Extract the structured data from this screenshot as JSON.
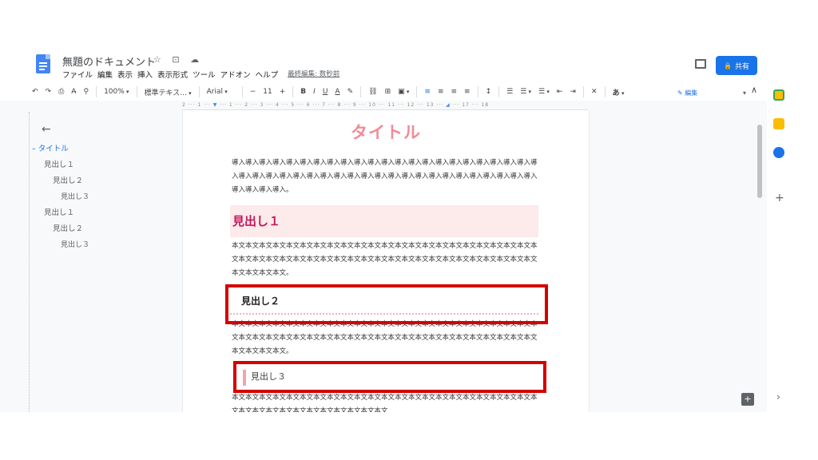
{
  "doc": {
    "title": "無題のドキュメント",
    "title_icons": "☆ ⊡ ☁",
    "menu": [
      "ファイル",
      "編集",
      "表示",
      "挿入",
      "表示形式",
      "ツール",
      "アドオン",
      "ヘルプ"
    ],
    "last_edit": "最終編集: 数秒前"
  },
  "header": {
    "share_label": "共有",
    "share_lock": "🔒"
  },
  "toolbar": {
    "undo": "↶",
    "redo": "↷",
    "print": "⎙",
    "spell": "A̶",
    "paint": "⚲",
    "zoom": "100%",
    "style": "標準テキス...",
    "font": "Arial",
    "minus": "−",
    "size": "11",
    "plus": "+",
    "bold": "B",
    "italic": "I",
    "underline": "U",
    "color": "A",
    "highlight": "✎",
    "link": "⛓",
    "comment": "⊞",
    "image": "▣",
    "align_left": "≡",
    "align_center": "≡",
    "align_right": "≡",
    "justify": "≡",
    "line_spacing": "↕",
    "checklist": "☰",
    "bullets": "☰",
    "numbers": "☰",
    "indent_less": "⇤",
    "indent_more": "⇥",
    "clear": "✕",
    "input": "あ",
    "mode": "編集",
    "collapse": "∧"
  },
  "ruler": {
    "marks": [
      "2",
      "1",
      "1",
      "2",
      "3",
      "4",
      "5",
      "6",
      "7",
      "8",
      "9",
      "10",
      "11",
      "12",
      "13",
      "14",
      "15",
      "17",
      "18"
    ]
  },
  "outline": {
    "back": "←",
    "items": [
      {
        "label": "タイトル",
        "level": 1,
        "active": true
      },
      {
        "label": "見出し１",
        "level": 1
      },
      {
        "label": "見出し２",
        "level": 2
      },
      {
        "label": "見出し３",
        "level": 3
      },
      {
        "label": "見出し１",
        "level": 1
      },
      {
        "label": "見出し２",
        "level": 2
      },
      {
        "label": "見出し３",
        "level": 3
      }
    ]
  },
  "document": {
    "title": "タイトル",
    "intro": "導入導入導入導入導入導入導入導入導入導入導入導入導入導入導入導入導入導入導入導入導入導入導入導入導入導入導入導入導入導入導入導入導入導入導入導入導入導入導入導入導入導入導入導入導入導入導入導入導入。",
    "h1": "見出し１",
    "body1": "本文本文本文本文本文本文本文本文本文本文本文本文本文本文本文本文本文本文本文本文本文本文本文本文本文本文本文本文本文本文本文本文本文本文本文本文本文本文本文本文本文本文本文本文本文本文本文本文本文。",
    "h2": "見出し２",
    "body2": "本文本文本文本文本文本文本文本文本文本文本文本文本文本文本文本文本文本文本文本文本文本文本文本文本文本文本文本文本文本文本文本文本文本文本文本文本文本文本文本文本文本文本文本文本文本文本文本文本文。",
    "h3": "見出し３",
    "body3": "本文本文本文本文本文本文本文本文本文本文本文本文本文本文本文本文本文本文本文本文本文本文本文本文本文本文本文本文本文本文本文本文本文本文"
  },
  "sidepanel": {
    "plus": "+",
    "chevron": "›",
    "explore": "+"
  },
  "colors": {
    "accent": "#1a73e8",
    "title_pink": "#f28b96",
    "highlight_red": "#d50000"
  }
}
